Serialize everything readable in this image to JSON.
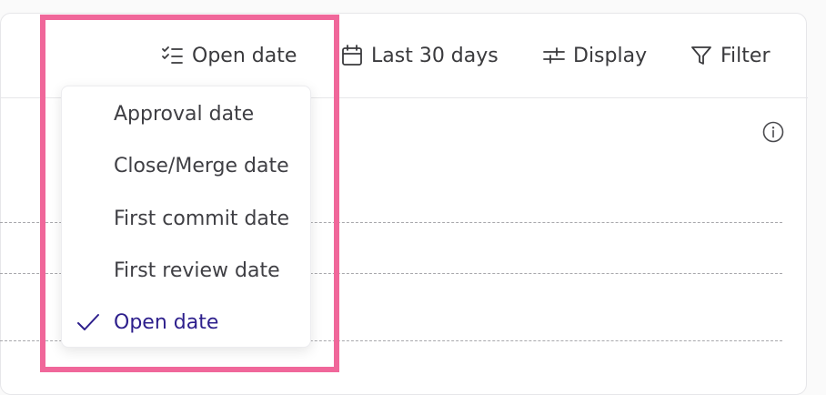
{
  "toolbar": {
    "date_field_label": "Open date",
    "date_range_label": "Last 30 days",
    "display_label": "Display",
    "filter_label": "Filter"
  },
  "dropdown": {
    "items": [
      {
        "label": "Approval date",
        "selected": false
      },
      {
        "label": "Close/Merge date",
        "selected": false
      },
      {
        "label": "First commit date",
        "selected": false
      },
      {
        "label": "First review date",
        "selected": false
      },
      {
        "label": "Open date",
        "selected": true
      }
    ]
  },
  "colors": {
    "highlight": "#f0679a",
    "selected_text": "#2d1f8c"
  },
  "icons": {
    "date_field": "checklist-icon",
    "date_range": "calendar-icon",
    "display": "sliders-icon",
    "filter": "funnel-icon",
    "info": "info-icon",
    "selected": "check-icon"
  }
}
